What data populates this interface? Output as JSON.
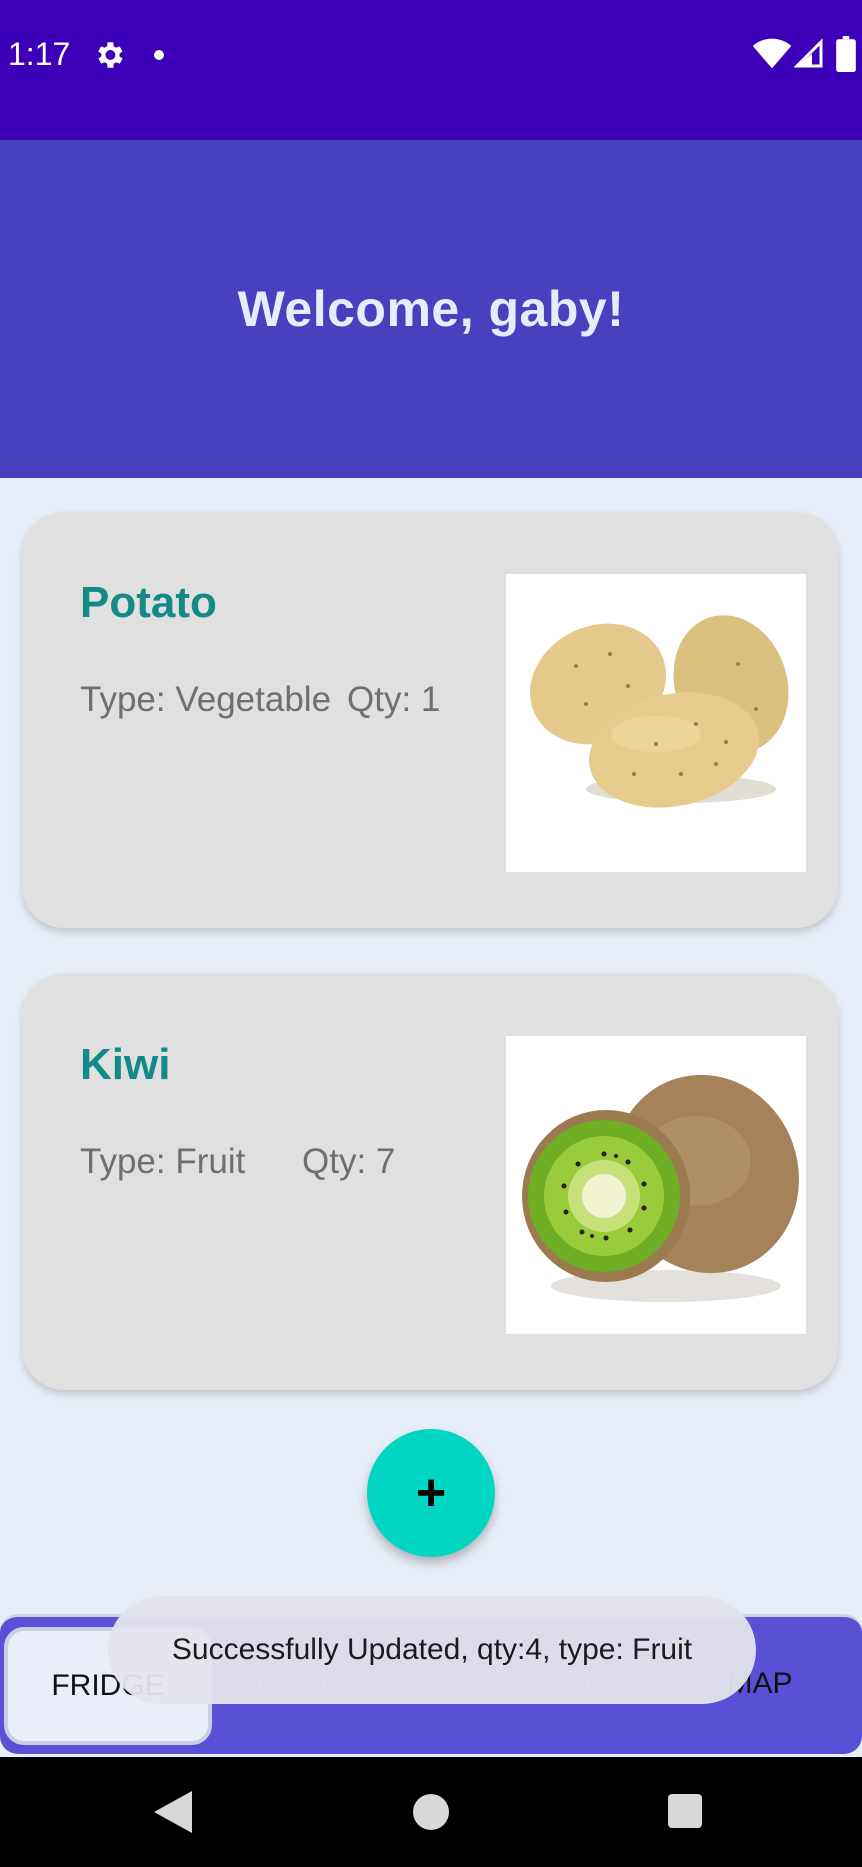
{
  "status_bar": {
    "time": "1:17",
    "icons": [
      "gear-icon",
      "notification-dot-icon",
      "wifi-icon",
      "signal-icon",
      "battery-icon"
    ]
  },
  "header": {
    "title": "Welcome, gaby!"
  },
  "items": [
    {
      "name": "Potato",
      "type_text": "Type: Vegetable",
      "qty_text": "Qty: 1",
      "image": "potato-image"
    },
    {
      "name": "Kiwi",
      "type_text": "Type: Fruit",
      "qty_text": "Qty: 7",
      "image": "kiwi-image"
    }
  ],
  "fab": {
    "label": "+"
  },
  "bottom_nav": {
    "tabs": [
      {
        "label": "FRIDGE",
        "selected": true
      },
      {
        "label": "RECIPES",
        "selected": false
      },
      {
        "label": "PROFILE",
        "selected": false
      },
      {
        "label": "MAP",
        "selected": false
      }
    ]
  },
  "toast": {
    "message": "Successfully Updated, qty:4, type: Fruit"
  },
  "system_nav": {
    "icons": [
      "back-icon",
      "home-icon",
      "recents-icon"
    ]
  },
  "colors": {
    "status_bar": "#3d00b8",
    "header": "#4940bf",
    "accent": "#00d6c2",
    "item_title": "#138a86",
    "bottom_nav": "#5950d6"
  }
}
